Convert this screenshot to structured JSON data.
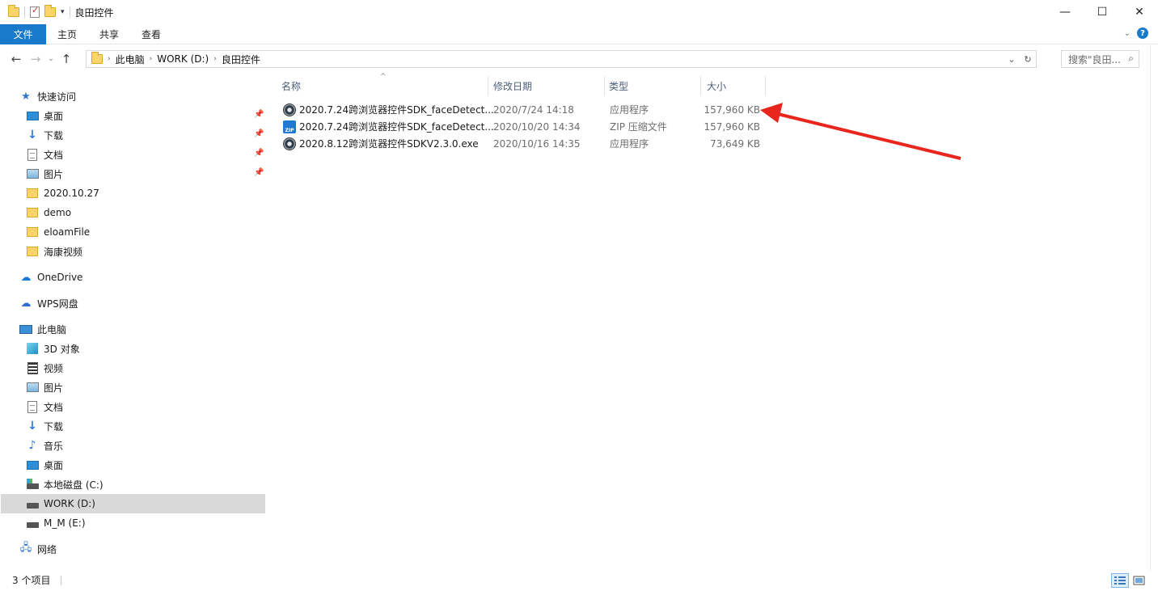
{
  "titlebar": {
    "title": "良田控件",
    "minimize": "—",
    "maximize": "☐",
    "close": "✕"
  },
  "ribbon": {
    "tabs": [
      "文件",
      "主页",
      "共享",
      "查看"
    ],
    "help": "?"
  },
  "address": {
    "crumbs": [
      "此电脑",
      "WORK (D:)",
      "良田控件"
    ],
    "search_placeholder": "搜索\"良田..."
  },
  "nav": {
    "quick_access": "快速访问",
    "pinned": [
      {
        "label": "桌面",
        "icon": "desktop-icon"
      },
      {
        "label": "下载",
        "icon": "download-icon"
      },
      {
        "label": "文档",
        "icon": "document-icon"
      },
      {
        "label": "图片",
        "icon": "pictures-icon"
      }
    ],
    "folders": [
      "2020.10.27",
      "demo",
      "eloamFile",
      "海康视频"
    ],
    "onedrive": "OneDrive",
    "wps": "WPS网盘",
    "this_pc": "此电脑",
    "pc_items": [
      {
        "label": "3D 对象",
        "icon": "3d-objects-icon"
      },
      {
        "label": "视频",
        "icon": "video-icon"
      },
      {
        "label": "图片",
        "icon": "pictures-icon"
      },
      {
        "label": "文档",
        "icon": "document-icon"
      },
      {
        "label": "下载",
        "icon": "download-icon"
      },
      {
        "label": "音乐",
        "icon": "music-icon"
      },
      {
        "label": "桌面",
        "icon": "desktop-icon"
      },
      {
        "label": "本地磁盘 (C:)",
        "icon": "system-drive-icon"
      },
      {
        "label": "WORK (D:)",
        "icon": "drive-icon",
        "selected": true
      },
      {
        "label": "M_M (E:)",
        "icon": "drive-icon"
      }
    ],
    "network": "网络"
  },
  "columns": {
    "name": "名称",
    "date": "修改日期",
    "type": "类型",
    "size": "大小"
  },
  "files": [
    {
      "name": "2020.7.24跨浏览器控件SDK_faceDetect...",
      "date": "2020/7/24 14:18",
      "type": "应用程序",
      "size": "157,960 KB",
      "icon": "exe-icon"
    },
    {
      "name": "2020.7.24跨浏览器控件SDK_faceDetect...",
      "date": "2020/10/20 14:34",
      "type": "ZIP 压缩文件",
      "size": "157,960 KB",
      "icon": "zip-icon"
    },
    {
      "name": "2020.8.12跨浏览器控件SDKV2.3.0.exe",
      "date": "2020/10/16 14:35",
      "type": "应用程序",
      "size": "73,649 KB",
      "icon": "exe-icon"
    }
  ],
  "status": {
    "item_count": "3 个项目"
  },
  "colors": {
    "accent": "#1979ca",
    "annotation_arrow": "#e8261e",
    "selected_bg": "#d9d9d9"
  }
}
